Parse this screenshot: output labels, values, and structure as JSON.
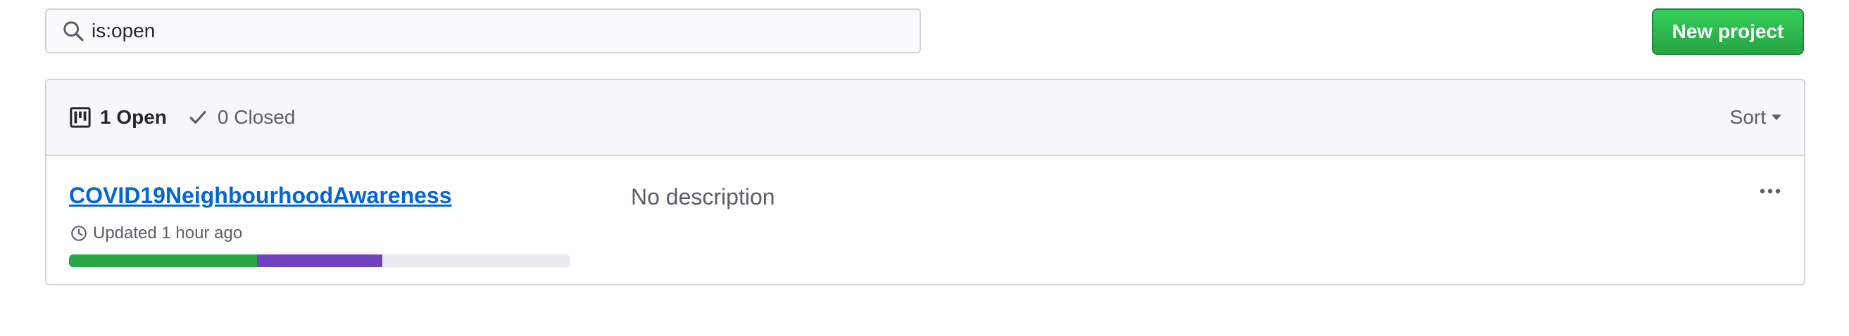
{
  "search": {
    "value": "is:open",
    "icon": "search-icon"
  },
  "toolbar": {
    "new_project_label": "New project"
  },
  "filters": {
    "open_label": "1 Open",
    "open_icon": "project-board-icon",
    "closed_label": "0 Closed",
    "closed_icon": "check-icon",
    "sort_label": "Sort"
  },
  "projects": [
    {
      "title": "COVID19NeighbourhoodAwareness",
      "updated": "Updated 1 hour ago",
      "description": "No description",
      "progress": {
        "done_percent": 37.5,
        "in_progress_percent": 25,
        "todo_percent": 37.5
      }
    }
  ],
  "colors": {
    "primary_button": "#28a745",
    "link": "#0366d6",
    "progress_done": "#28a745",
    "progress_in_progress": "#6f42c1",
    "progress_todo": "#eaecef"
  }
}
